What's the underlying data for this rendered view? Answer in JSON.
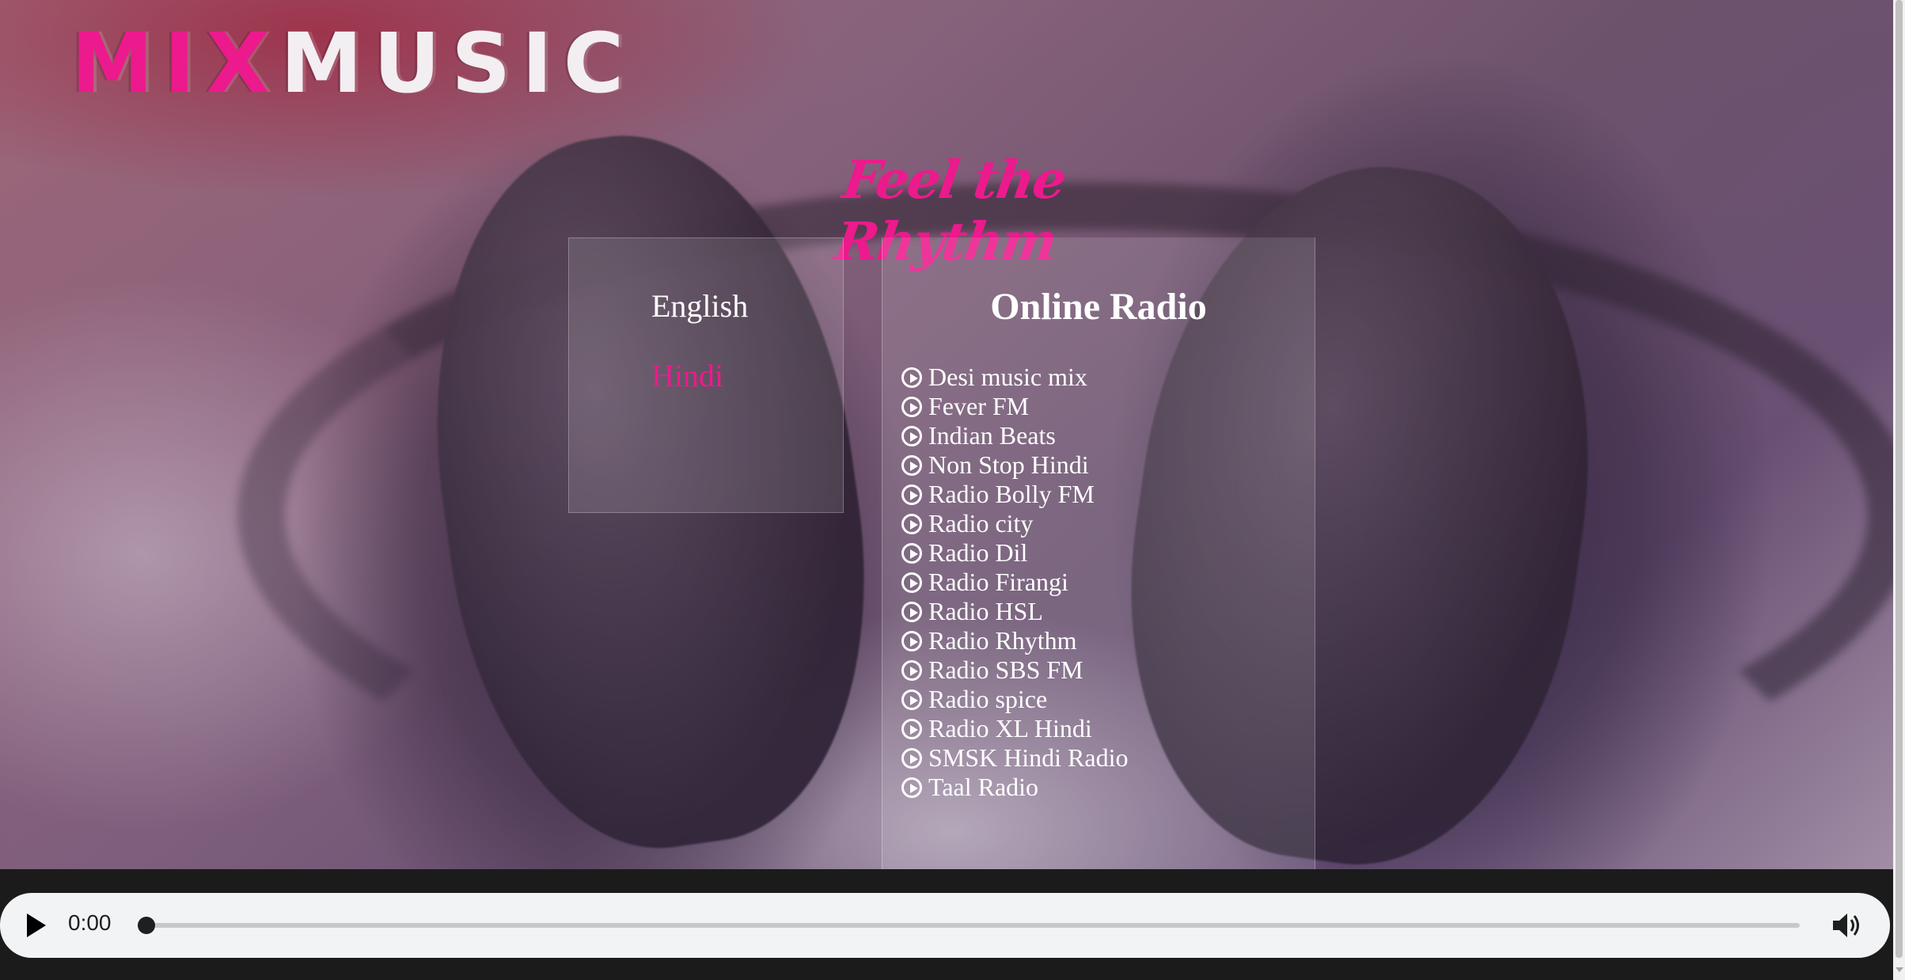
{
  "logo": {
    "part1": "MIX",
    "part2": "MUSIC"
  },
  "tagline": "Feel the Rhythm",
  "languages": [
    {
      "label": "English",
      "active": false
    },
    {
      "label": "Hindi",
      "active": true
    }
  ],
  "radio": {
    "title": "Online Radio",
    "stations": [
      "Desi music mix",
      "Fever FM",
      "Indian Beats",
      "Non Stop Hindi",
      "Radio Bolly FM",
      "Radio city",
      "Radio Dil",
      "Radio Firangi",
      "Radio HSL",
      "Radio Rhythm",
      "Radio SBS FM",
      "Radio spice",
      "Radio XL Hindi",
      "SMSK Hindi Radio",
      "Taal Radio"
    ],
    "station_icon": "play-circle-icon"
  },
  "player": {
    "time": "0:00",
    "progress": 0,
    "play_icon": "play-icon",
    "volume_icon": "volume-icon"
  },
  "colors": {
    "accent": "#ec1a8c",
    "text": "#ffffff",
    "player_bg": "#f1f3f4",
    "footer_bg": "#1c1b1b"
  }
}
